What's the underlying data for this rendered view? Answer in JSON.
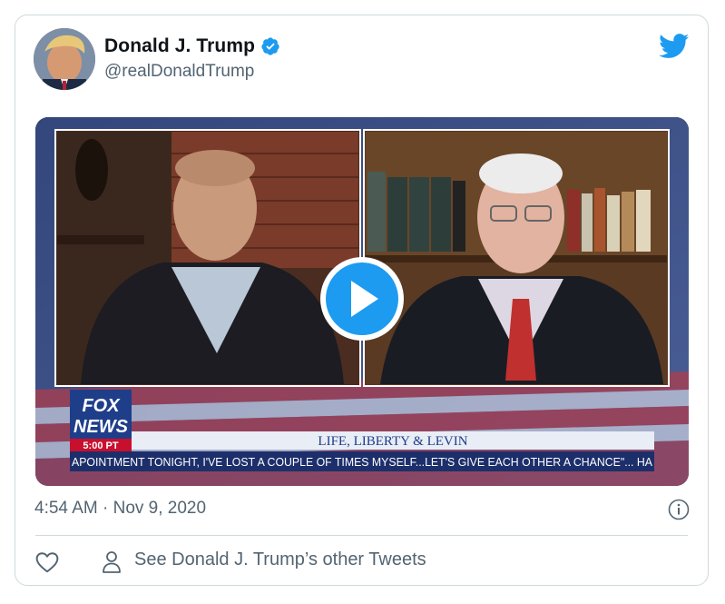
{
  "tweet": {
    "author_name": "Donald J. Trump",
    "author_handle": "@realDonaldTrump",
    "timestamp": "4:54 AM · Nov 9, 2020",
    "other_tweets_label": "See Donald J. Trump’s other Tweets"
  },
  "video": {
    "channel_logo_top": "FOX",
    "channel_logo_bottom": "NEWS",
    "channel_time": "5:00 PT",
    "show_title": "LIFE, LIBERTY & LEVIN",
    "ticker": "APOINTMENT TONIGHT, I'VE LOST A COUPLE OF TIMES MYSELF...LET'S GIVE EACH OTHER A CHANCE\"... HA"
  },
  "icons": {
    "verified": "verified-badge-icon",
    "brand": "twitter-bird-icon",
    "play": "play-icon",
    "info": "info-icon",
    "like": "heart-icon",
    "profile": "person-icon"
  },
  "colors": {
    "brand_blue": "#1d9bf0",
    "muted_text": "#536471",
    "border": "#cfd9de",
    "fox_red": "#c8102e"
  }
}
